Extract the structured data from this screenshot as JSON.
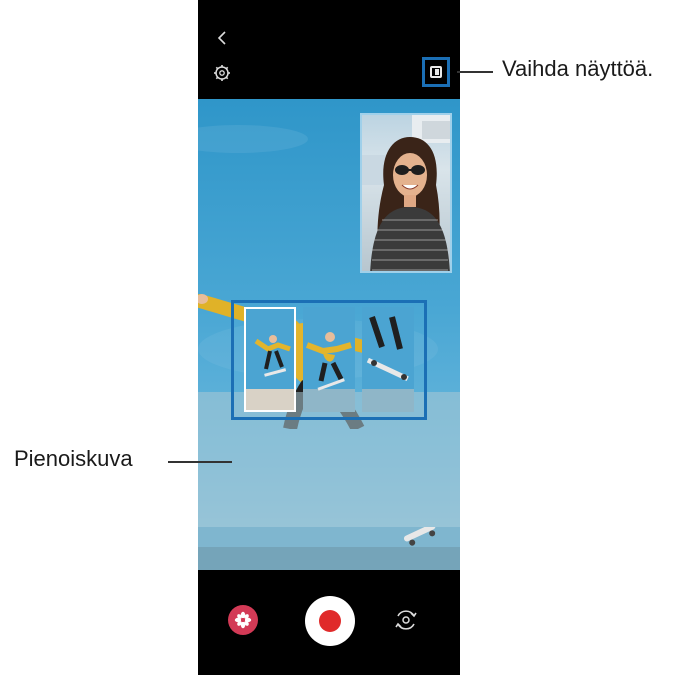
{
  "callouts": {
    "switch_screen": "Vaihda näyttöä.",
    "thumbnail": "Pienoiskuva"
  },
  "icons": {
    "back": "chevron-left-icon",
    "settings": "gear-icon",
    "switch_screen": "switch-screen-icon",
    "effects": "flower-icon",
    "record": "record-icon",
    "flip_camera": "flip-camera-icon"
  },
  "colors": {
    "accent_highlight": "#1b6fb5",
    "record": "#e02a2a",
    "effects": "#d33a56"
  }
}
